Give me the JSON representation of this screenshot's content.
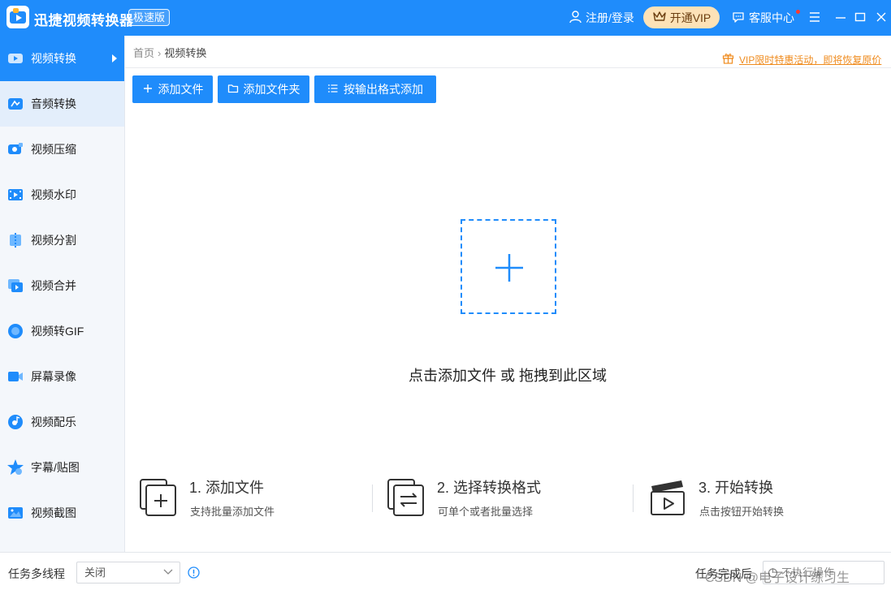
{
  "app": {
    "title": "迅捷视频转换器",
    "edition": "极速版"
  },
  "header": {
    "login": "注册/登录",
    "vip": "开通VIP",
    "service": "客服中心"
  },
  "sidebar": {
    "items": [
      {
        "label": "视频转换",
        "icon": "video-convert-icon"
      },
      {
        "label": "音频转换",
        "icon": "audio-convert-icon"
      },
      {
        "label": "视频压缩",
        "icon": "video-compress-icon"
      },
      {
        "label": "视频水印",
        "icon": "video-watermark-icon"
      },
      {
        "label": "视频分割",
        "icon": "video-split-icon"
      },
      {
        "label": "视频合并",
        "icon": "video-merge-icon"
      },
      {
        "label": "视频转GIF",
        "icon": "video-gif-icon"
      },
      {
        "label": "屏幕录像",
        "icon": "screen-record-icon"
      },
      {
        "label": "视频配乐",
        "icon": "video-music-icon"
      },
      {
        "label": "字幕/贴图",
        "icon": "subtitle-sticker-icon"
      },
      {
        "label": "视频截图",
        "icon": "video-screenshot-icon"
      }
    ]
  },
  "breadcrumb": {
    "home": "首页",
    "separator": "›",
    "current": "视频转换"
  },
  "promo": "VIP限时特惠活动，即将恢复原价",
  "toolbar": {
    "add_file": "添加文件",
    "add_folder": "添加文件夹",
    "add_by_format": "按输出格式添加"
  },
  "dropzone": {
    "text": "点击添加文件 或 拖拽到此区域"
  },
  "steps": [
    {
      "title": "1. 添加文件",
      "desc": "支持批量添加文件"
    },
    {
      "title": "2. 选择转换格式",
      "desc": "可单个或者批量选择"
    },
    {
      "title": "3. 开始转换",
      "desc": "点击按钮开始转换"
    }
  ],
  "bottom": {
    "multithread_label": "任务多线程",
    "multithread_value": "关闭",
    "after_label": "任务完成后",
    "after_value": "不执行操作"
  },
  "watermark": "CSDN @电子设计练习生",
  "colors": {
    "primary": "#1f8cfb",
    "vip_bg": "#fde2b7",
    "promo": "#ef8b1e"
  }
}
